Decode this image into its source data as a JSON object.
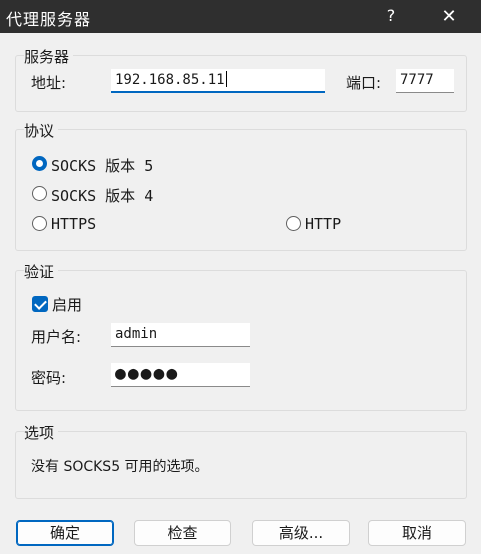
{
  "window": {
    "title": "代理服务器",
    "help_label": "?",
    "close_label": "✕"
  },
  "server": {
    "group_title": "服务器",
    "address_label": "地址:",
    "address_value": "192.168.85.11",
    "port_label": "端口:",
    "port_value": "7777"
  },
  "protocol": {
    "group_title": "协议",
    "options": [
      {
        "label": "SOCKS 版本 5",
        "selected": true
      },
      {
        "label": "SOCKS 版本 4",
        "selected": false
      },
      {
        "label": "HTTPS",
        "selected": false
      },
      {
        "label": "HTTP",
        "selected": false
      }
    ]
  },
  "auth": {
    "group_title": "验证",
    "enable_label": "启用",
    "enabled": true,
    "username_label": "用户名:",
    "username_value": "admin",
    "password_label": "密码:",
    "password_mask": "●●●●●"
  },
  "options": {
    "group_title": "选项",
    "message": "没有 SOCKS5 可用的选项。"
  },
  "buttons": {
    "ok": "确定",
    "check": "检查",
    "advanced": "高级...",
    "cancel": "取消"
  },
  "colors": {
    "accent": "#0067c0",
    "titlebar": "#2f2f2f",
    "background": "#f0f0f0"
  }
}
